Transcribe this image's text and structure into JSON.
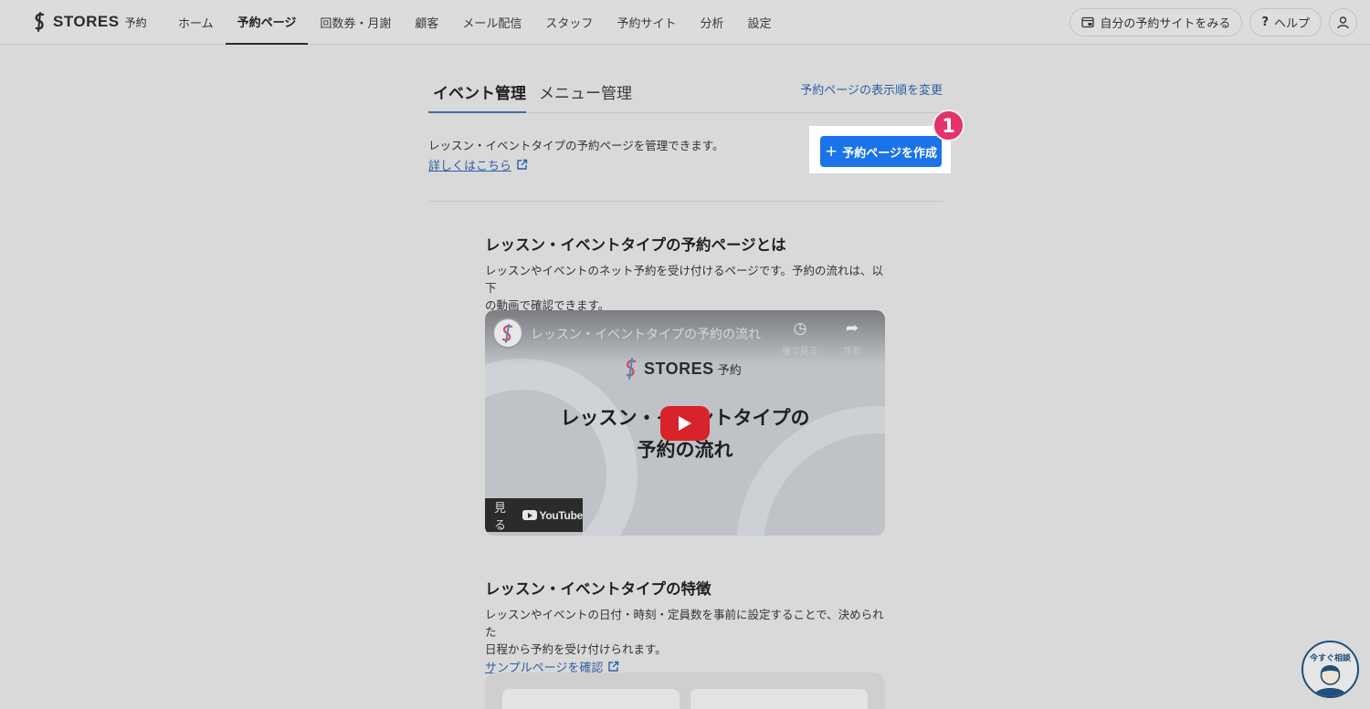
{
  "header": {
    "logo_text": "STORES",
    "logo_sub": "予約",
    "nav": [
      {
        "label": "ホーム",
        "active": false
      },
      {
        "label": "予約ページ",
        "active": true
      },
      {
        "label": "回数券・月謝",
        "active": false
      },
      {
        "label": "顧客",
        "active": false
      },
      {
        "label": "メール配信",
        "active": false
      },
      {
        "label": "スタッフ",
        "active": false
      },
      {
        "label": "予約サイト",
        "active": false
      },
      {
        "label": "分析",
        "active": false
      },
      {
        "label": "設定",
        "active": false
      }
    ],
    "view_site_label": "自分の予約サイトをみる",
    "help_label": "ヘルプ"
  },
  "tabs": {
    "event": "イベント管理",
    "menu": "メニュー管理"
  },
  "reorder_link": "予約ページの表示順を変更",
  "description": "レッスン・イベントタイプの予約ページを管理できます。",
  "detail_link": "詳しくはこちら",
  "create_button": "予約ページを作成",
  "step_badge": "1",
  "section1": {
    "title": "レッスン・イベントタイプの予約ページとは",
    "body_line1": "レッスンやイベントのネット予約を受け付けるページです。予約の流れは、以下",
    "body_line2": "の動画で確認できます。"
  },
  "video": {
    "title": "レッスン・イベントタイプの予約の流れ",
    "watch_later": "後で見る",
    "share": "共有",
    "logo_text": "STORES",
    "logo_sub": "予約",
    "headline1": "レッスン・イベントタイプの",
    "headline2": "予約の流れ",
    "watch_on": "見る",
    "youtube": "YouTube"
  },
  "section2": {
    "title": "レッスン・イベントタイプの特徴",
    "body_line1": "レッスンやイベントの日付・時刻・定員数を事前に設定することで、決められた",
    "body_line2": "日程から予約を受け付けられます。",
    "link": "サンプルページを確認"
  },
  "chat_label": "今すぐ相談",
  "colors": {
    "primary": "#1a73e8",
    "badge": "#e2336b",
    "link": "#2d5fa5"
  }
}
